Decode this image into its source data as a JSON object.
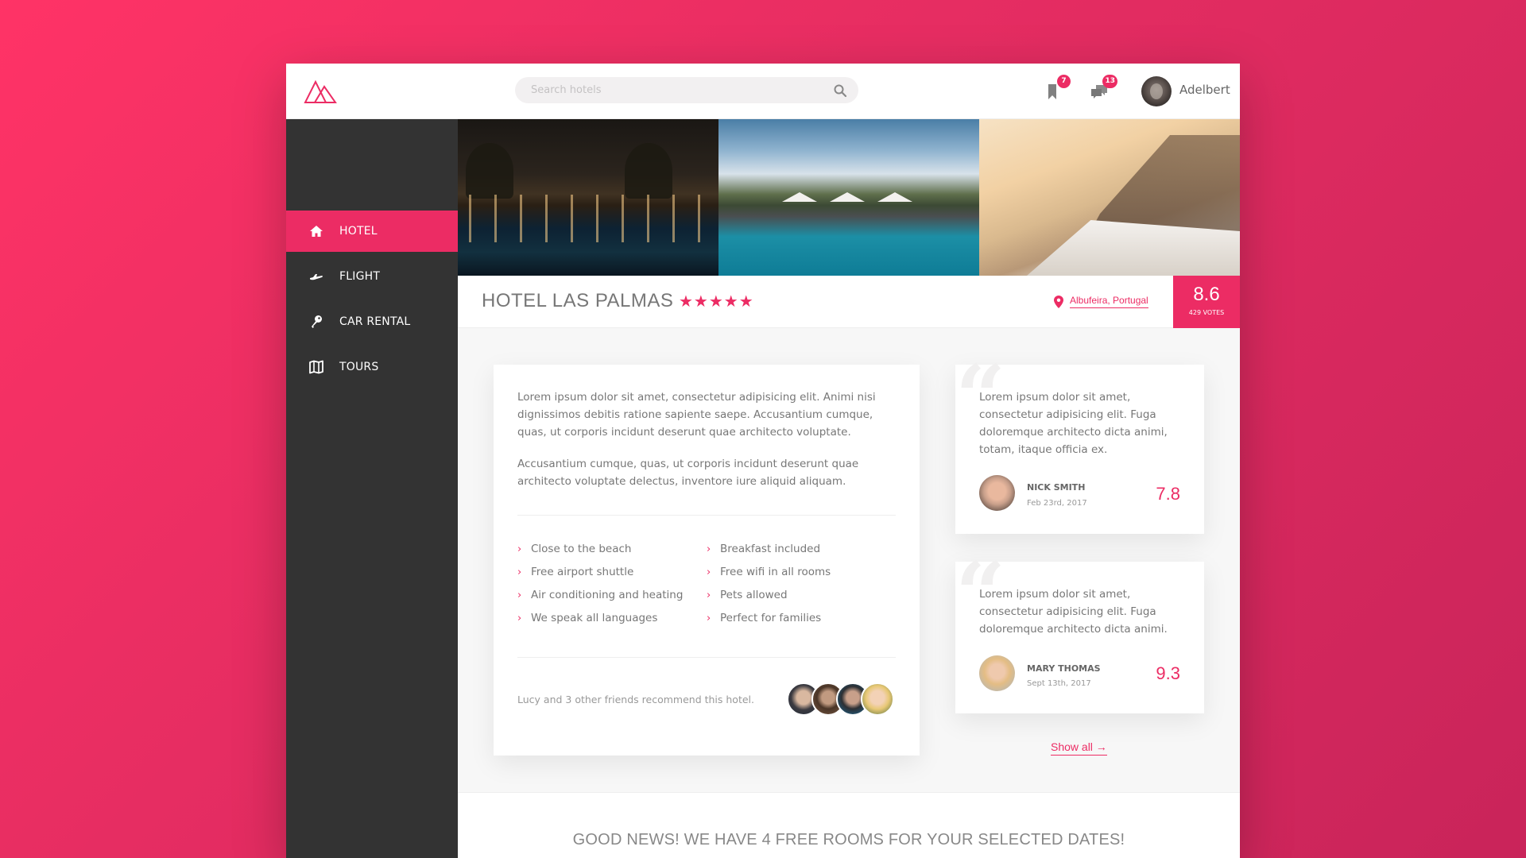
{
  "header": {
    "search_placeholder": "Search hotels",
    "bookmarks_count": "7",
    "messages_count": "13",
    "username": "Adelbert"
  },
  "sidebar": {
    "items": [
      {
        "label": "HOTEL",
        "icon": "home-icon",
        "active": true
      },
      {
        "label": "FLIGHT",
        "icon": "plane-icon",
        "active": false
      },
      {
        "label": "CAR RENTAL",
        "icon": "key-icon",
        "active": false
      },
      {
        "label": "TOURS",
        "icon": "map-icon",
        "active": false
      }
    ]
  },
  "hotel": {
    "name": "HOTEL LAS PALMAS",
    "stars": "★★★★★",
    "star_rating": 5,
    "location": "Albufeira, Portugal",
    "score": "8.6",
    "votes": "429 VOTES"
  },
  "description": {
    "paragraphs": [
      "Lorem ipsum dolor sit amet, consectetur adipisicing elit. Animi nisi dignissimos debitis ratione sapiente saepe. Accusantium cumque, quas, ut corporis incidunt deserunt quae architecto voluptate.",
      "Accusantium cumque, quas, ut corporis incidunt deserunt quae architecto voluptate delectus, inventore iure aliquid aliquam."
    ],
    "features": [
      "Close to the beach",
      "Free airport shuttle",
      "Air conditioning and heating",
      "We speak all languages",
      "Breakfast included",
      "Free wifi in all rooms",
      "Pets allowed",
      "Perfect for families"
    ],
    "recommend_text": "Lucy and 3 other friends recommend this hotel."
  },
  "reviews": [
    {
      "text": "Lorem ipsum dolor sit amet, consectetur adipisicing elit. Fuga doloremque architecto dicta animi, totam, itaque officia ex.",
      "name": "NICK SMITH",
      "date": "Feb 23rd, 2017",
      "score": "7.8"
    },
    {
      "text": "Lorem ipsum dolor sit amet, consectetur adipisicing elit. Fuga doloremque architecto dicta animi.",
      "name": "MARY THOMAS",
      "date": "Sept 13th, 2017",
      "score": "9.3"
    }
  ],
  "show_all": "Show all  →",
  "banner": "GOOD NEWS! WE HAVE 4 FREE ROOMS FOR YOUR SELECTED DATES!",
  "colors": {
    "accent": "#ec2c64",
    "sidebar": "#333333",
    "background_gradient": [
      "#ff3366",
      "#c9245a"
    ]
  }
}
